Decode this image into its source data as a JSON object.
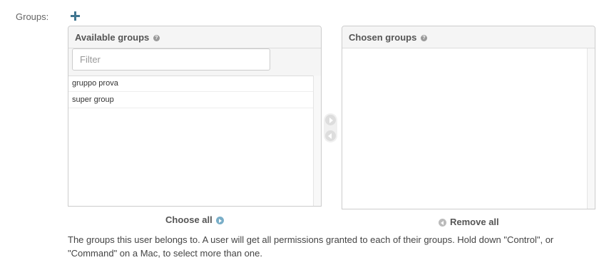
{
  "field": {
    "label": "Groups:"
  },
  "colors": {
    "accent": "#417690",
    "link_circle": "#79aec8",
    "header_bg": "#f5f5f5",
    "border": "#cccccc"
  },
  "icons": {
    "add": "plus-icon",
    "help": "question-circle-icon",
    "choose": "arrow-right-circle-icon",
    "remove": "arrow-left-circle-icon"
  },
  "available": {
    "title": "Available groups",
    "help_glyph": "?",
    "filter": {
      "placeholder": "Filter",
      "value": ""
    },
    "options": [
      {
        "label": "gruppo prova"
      },
      {
        "label": "super group"
      }
    ],
    "choose_all": "Choose all"
  },
  "chosen": {
    "title": "Chosen groups",
    "help_glyph": "?",
    "options": [],
    "remove_all": "Remove all"
  },
  "help_text": "The groups this user belongs to. A user will get all permissions granted to each of their groups. Hold down \"Control\", or \"Command\" on a Mac, to select more than one."
}
